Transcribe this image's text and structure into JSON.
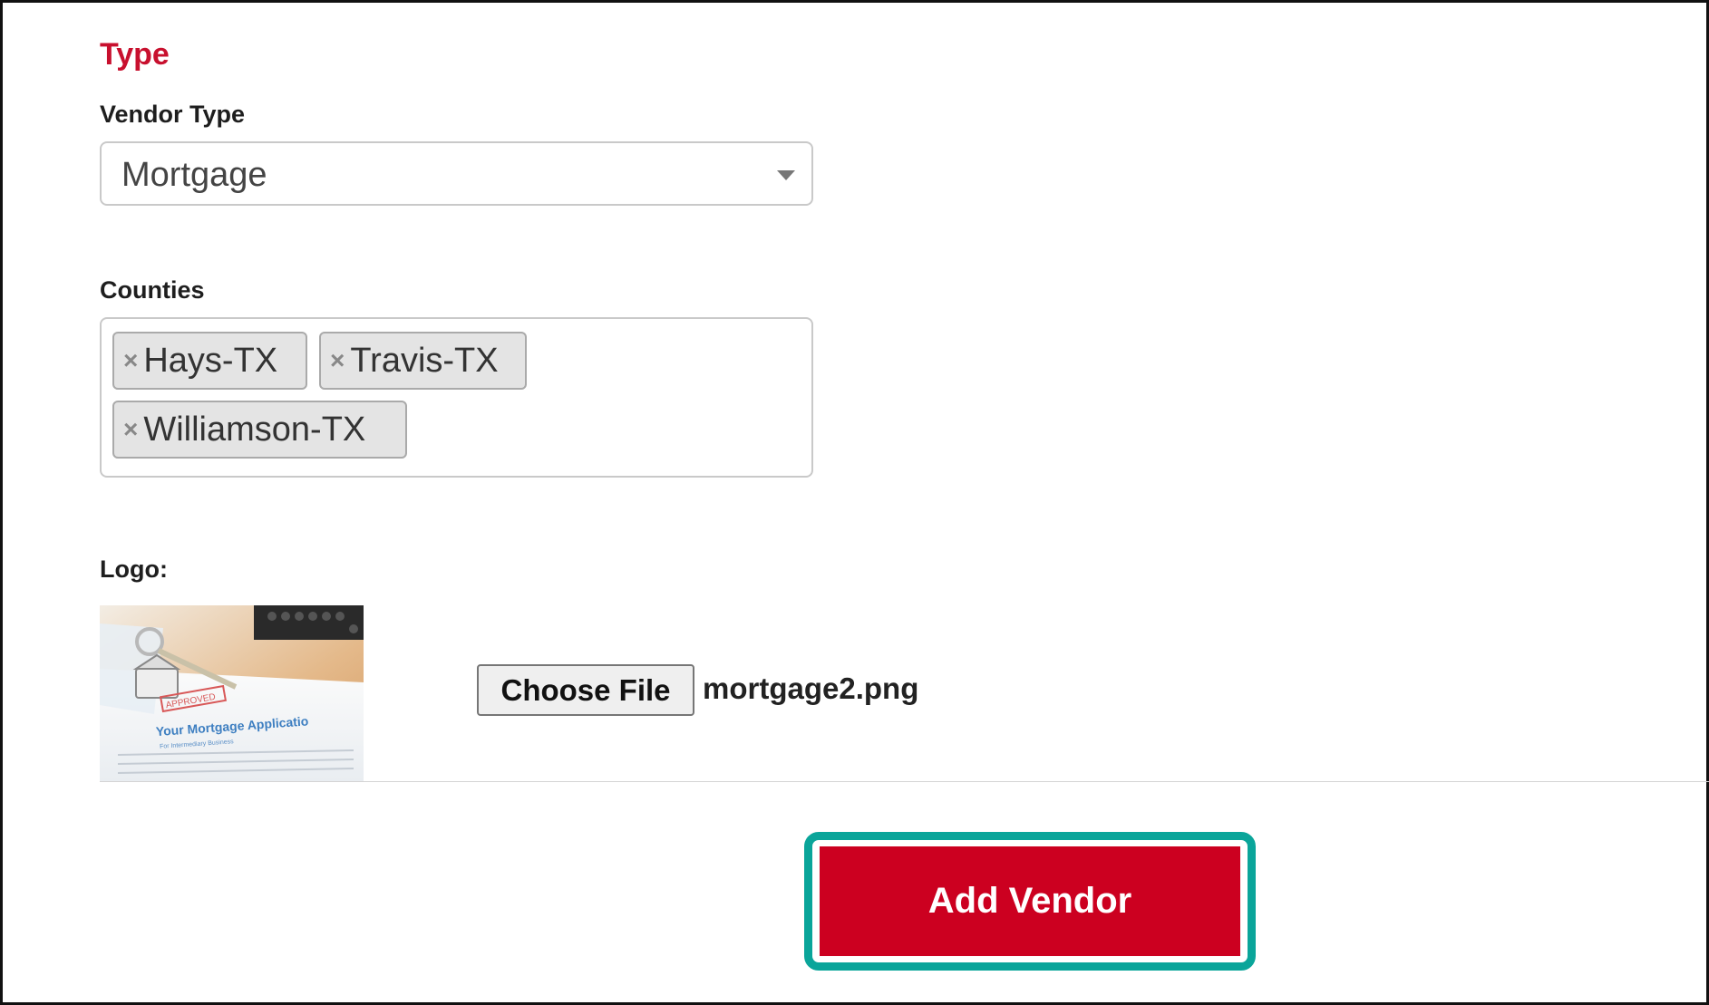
{
  "section": {
    "title": "Type"
  },
  "vendor_type": {
    "label": "Vendor Type",
    "selected": "Mortgage",
    "caret_icon": "chevron-down-icon"
  },
  "counties": {
    "label": "Counties",
    "remove_glyph": "×",
    "tags": [
      "Hays-TX",
      "Travis-TX",
      "Williamson-TX"
    ]
  },
  "logo": {
    "label": "Logo:",
    "thumbnail_text": {
      "stamp": "APPROVED",
      "heading": "Your Mortgage Applicatio",
      "subheading": "For Intermediary Business"
    },
    "choose_file_label": "Choose File",
    "file_name": "mortgage2.png"
  },
  "actions": {
    "add_vendor_label": "Add Vendor"
  },
  "colors": {
    "accent_red": "#c8102e",
    "button_red": "#cc0020",
    "highlight_teal": "#0aa59a"
  }
}
